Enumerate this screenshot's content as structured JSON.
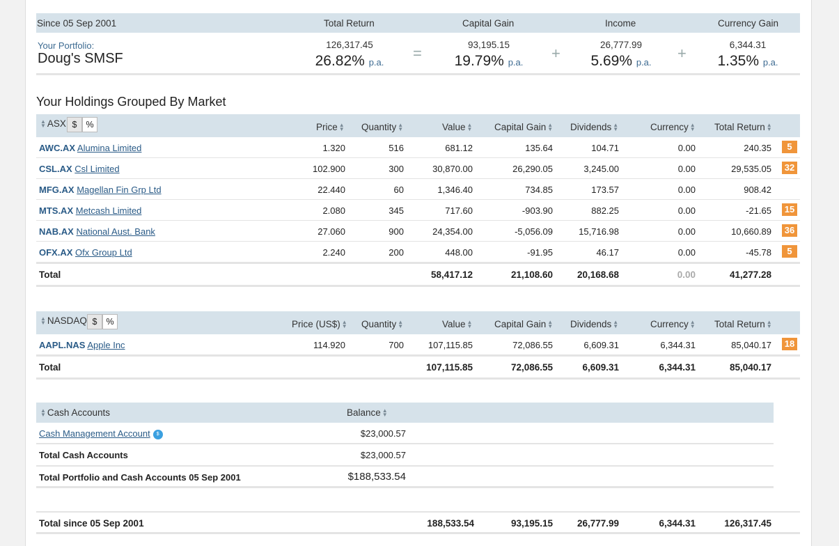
{
  "summary": {
    "since_label": "Since 05 Sep 2001",
    "headers": {
      "total_return": "Total Return",
      "capital_gain": "Capital Gain",
      "income": "Income",
      "currency_gain": "Currency Gain"
    },
    "portfolio_label": "Your Portfolio:",
    "portfolio_name": "Doug's SMSF",
    "total_return": {
      "amount": "126,317.45",
      "pct": "26.82%",
      "pa": "p.a."
    },
    "capital_gain": {
      "amount": "93,195.15",
      "pct": "19.79%",
      "pa": "p.a."
    },
    "income": {
      "amount": "26,777.99",
      "pct": "5.69%",
      "pa": "p.a."
    },
    "currency_gain": {
      "amount": "6,344.31",
      "pct": "1.35%",
      "pa": "p.a."
    },
    "op_equals": "=",
    "op_plus": "+"
  },
  "holdings_title": "Your Holdings Grouped By Market",
  "asx": {
    "market": "ASX",
    "toggle_dollar": "$",
    "toggle_pct": "%",
    "columns": {
      "price": "Price",
      "quantity": "Quantity",
      "value": "Value",
      "capital_gain": "Capital Gain",
      "dividends": "Dividends",
      "currency": "Currency",
      "total_return": "Total Return"
    },
    "rows": [
      {
        "code": "AWC.AX",
        "name": "Alumina Limited",
        "price": "1.320",
        "qty": "516",
        "value": "681.12",
        "cg": "135.64",
        "div": "104.71",
        "cur": "0.00",
        "tr": "240.35",
        "badge": "5"
      },
      {
        "code": "CSL.AX",
        "name": "Csl Limited",
        "price": "102.900",
        "qty": "300",
        "value": "30,870.00",
        "cg": "26,290.05",
        "div": "3,245.00",
        "cur": "0.00",
        "tr": "29,535.05",
        "badge": "32"
      },
      {
        "code": "MFG.AX",
        "name": "Magellan Fin Grp Ltd",
        "price": "22.440",
        "qty": "60",
        "value": "1,346.40",
        "cg": "734.85",
        "div": "173.57",
        "cur": "0.00",
        "tr": "908.42",
        "badge": ""
      },
      {
        "code": "MTS.AX",
        "name": "Metcash Limited",
        "price": "2.080",
        "qty": "345",
        "value": "717.60",
        "cg": "-903.90",
        "div": "882.25",
        "cur": "0.00",
        "tr": "-21.65",
        "badge": "15"
      },
      {
        "code": "NAB.AX",
        "name": "National Aust. Bank",
        "price": "27.060",
        "qty": "900",
        "value": "24,354.00",
        "cg": "-5,056.09",
        "div": "15,716.98",
        "cur": "0.00",
        "tr": "10,660.89",
        "badge": "36"
      },
      {
        "code": "OFX.AX",
        "name": "Ofx Group Ltd",
        "price": "2.240",
        "qty": "200",
        "value": "448.00",
        "cg": "-91.95",
        "div": "46.17",
        "cur": "0.00",
        "tr": "-45.78",
        "badge": "5"
      }
    ],
    "total": {
      "label": "Total",
      "value": "58,417.12",
      "cg": "21,108.60",
      "div": "20,168.68",
      "cur": "0.00",
      "tr": "41,277.28"
    }
  },
  "nasdaq": {
    "market": "NASDAQ",
    "toggle_dollar": "$",
    "toggle_pct": "%",
    "columns": {
      "price": "Price (US$)",
      "quantity": "Quantity",
      "value": "Value",
      "capital_gain": "Capital Gain",
      "dividends": "Dividends",
      "currency": "Currency",
      "total_return": "Total Return"
    },
    "rows": [
      {
        "code": "AAPL.NAS",
        "name": "Apple Inc",
        "price": "114.920",
        "qty": "700",
        "value": "107,115.85",
        "cg": "72,086.55",
        "div": "6,609.31",
        "cur": "6,344.31",
        "tr": "85,040.17",
        "badge": "18"
      }
    ],
    "total": {
      "label": "Total",
      "value": "107,115.85",
      "cg": "72,086.55",
      "div": "6,609.31",
      "cur": "6,344.31",
      "tr": "85,040.17"
    }
  },
  "cash": {
    "header": "Cash Accounts",
    "balance_header": "Balance",
    "account_name": "Cash Management Account",
    "account_icon": "bank-icon",
    "account_balance": "$23,000.57",
    "total_label": "Total Cash Accounts",
    "total_balance": "$23,000.57",
    "portfolio_total_label": "Total Portfolio and Cash Accounts 05 Sep 2001",
    "portfolio_total": "$188,533.54"
  },
  "grand_total": {
    "label": "Total since 05 Sep 2001",
    "value": "188,533.54",
    "cg": "93,195.15",
    "div": "26,777.99",
    "cur": "6,344.31",
    "tr": "126,317.45"
  },
  "colors": {
    "header_bg": "#d6e2ea",
    "link": "#2a5b87",
    "negative": "#d9362b",
    "badge": "#f0953a"
  }
}
